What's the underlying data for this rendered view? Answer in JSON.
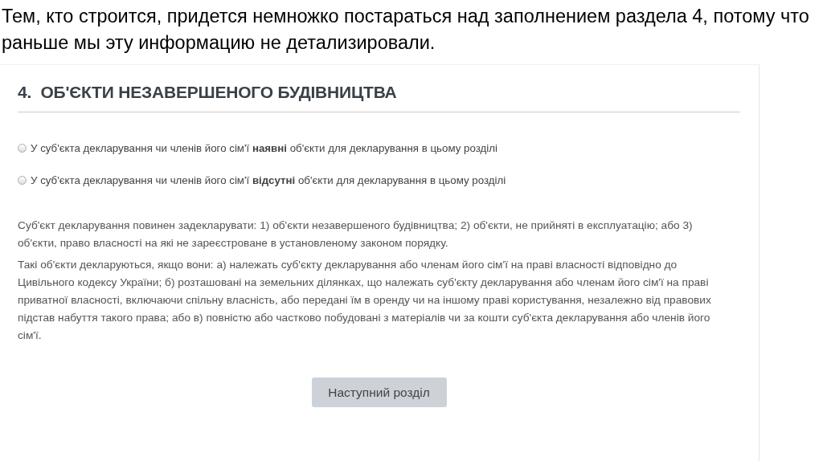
{
  "slide_caption": "Тем, кто строится, придется немножко постараться над заполнением раздела 4, потому что раньше мы эту информацию не детализировали.",
  "section": {
    "title": "4.  ОБ'ЄКТИ НЕЗАВЕРШЕНОГО БУДІВНИЦТВА",
    "radios": [
      {
        "label": "У суб'єкта декларування чи членів його сім'ї **наявні** об'єкти для декларування в цьому розділі",
        "selected": false
      },
      {
        "label": "У суб'єкта декларування чи членів його сім'ї **відсутні** об'єкти для декларування в цьому розділі",
        "selected": false
      }
    ],
    "paragraphs": [
      "Суб'єкт декларування повинен задекларувати: 1) об'єкти незавершеного будівництва; 2) об'єкти, не прийняті в експлуатацію; або 3) об'єкти, право власності на які не зареєстроване в установленому законом порядку.",
      "Такі об'єкти декларуються, якщо вони: а) належать суб'єкту декларування або членам його сім'ї на праві власності відповідно до Цивільного кодексу України; б) розташовані на земельних ділянках, що належать суб'єкту декларування або членам його сім'ї на праві приватної власності, включаючи спільну власність, або передані їм в оренду чи на іншому праві користування, незалежно від правових підстав набуття такого права; або в) повністю або частково побудовані з матеріалів чи за кошти суб'єкта декларування або членів його сім'ї."
    ],
    "next_button": "Наступний розділ"
  }
}
